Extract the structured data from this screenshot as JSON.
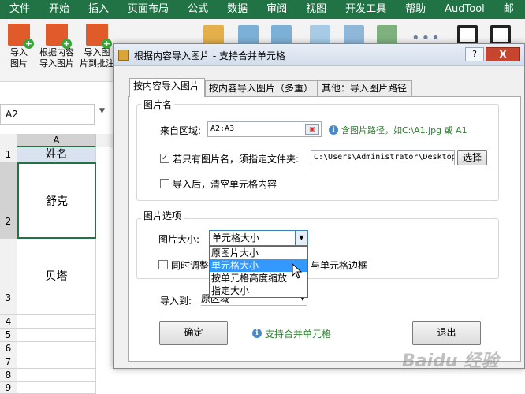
{
  "ribbon": {
    "tabs": [
      "文件",
      "开始",
      "插入",
      "页面布局",
      "公式",
      "数据",
      "审阅",
      "视图",
      "开发工具",
      "帮助",
      "AudTool",
      "邮"
    ],
    "buttons": [
      {
        "label1": "导入",
        "label2": "图片"
      },
      {
        "label1": "根据内容",
        "label2": "导入图片"
      },
      {
        "label1": "导入图",
        "label2": "片到批注"
      }
    ]
  },
  "namebox": {
    "value": "A2"
  },
  "sheet": {
    "column_header": "A",
    "row_numbers": [
      "1",
      "2",
      "3",
      "4",
      "5",
      "6",
      "7",
      "8",
      "9"
    ],
    "cells": {
      "a1": "姓名",
      "a2": "舒克",
      "a3": "贝塔"
    }
  },
  "dialog": {
    "title": "根据内容导入图片 - 支持合并单元格",
    "help_label": "?",
    "close_label": "X",
    "tabs": [
      "按内容导入图片",
      "按内容导入图片（多重）",
      "其他：导入图片路径"
    ],
    "group_name": {
      "title": "图片名",
      "source_label": "来自区域:",
      "source_value": "A2:A3",
      "hint": "含图片路径，如C:\\A1.jpg 或 A1",
      "folder_checkbox_label": "若只有图片名，须指定文件夹:",
      "folder_checked": true,
      "folder_value": "C:\\Users\\Administrator\\Desktop",
      "browse_label": "选择",
      "clear_checkbox_label": "导入后，清空单元格内容",
      "clear_checked": false
    },
    "group_options": {
      "title": "图片选项",
      "size_label": "图片大小:",
      "size_selected": "单元格大小",
      "size_options": [
        "原图片大小",
        "单元格大小",
        "按单元格高度缩放",
        "指定大小"
      ],
      "adjust_checkbox_label_left": "同时调整",
      "adjust_checkbox_label_right": "与单元格边框",
      "adjust_checked": false
    },
    "import_to_label": "导入到:",
    "import_to_value": "原区域",
    "ok_label": "确定",
    "merge_hint": "支持合并单元格",
    "exit_label": "退出"
  },
  "watermark": "Baidu 经验",
  "colors": {
    "excel_green": "#217346",
    "selection_blue": "#3399ff",
    "close_red": "#c7452e",
    "hint_green": "#2e7d32"
  }
}
